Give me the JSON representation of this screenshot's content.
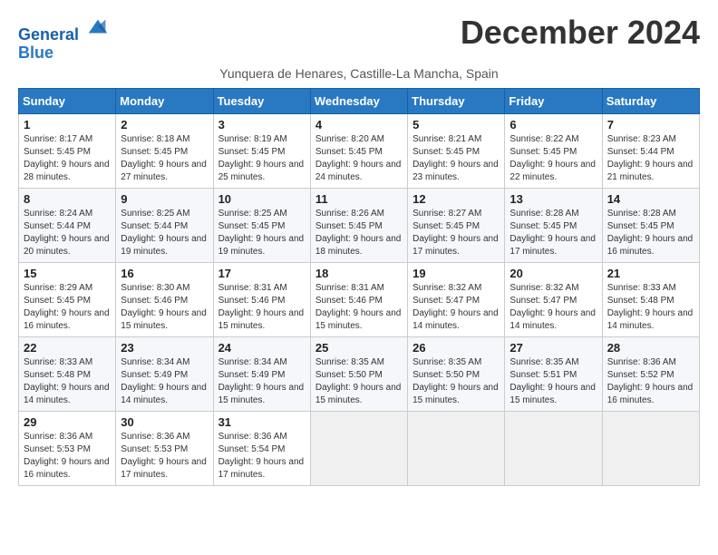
{
  "logo": {
    "line1": "General",
    "line2": "Blue"
  },
  "title": "December 2024",
  "subtitle": "Yunquera de Henares, Castille-La Mancha, Spain",
  "headers": [
    "Sunday",
    "Monday",
    "Tuesday",
    "Wednesday",
    "Thursday",
    "Friday",
    "Saturday"
  ],
  "weeks": [
    [
      {
        "day": "1",
        "sunrise": "8:17 AM",
        "sunset": "5:45 PM",
        "daylight": "9 hours and 28 minutes."
      },
      {
        "day": "2",
        "sunrise": "8:18 AM",
        "sunset": "5:45 PM",
        "daylight": "9 hours and 27 minutes."
      },
      {
        "day": "3",
        "sunrise": "8:19 AM",
        "sunset": "5:45 PM",
        "daylight": "9 hours and 25 minutes."
      },
      {
        "day": "4",
        "sunrise": "8:20 AM",
        "sunset": "5:45 PM",
        "daylight": "9 hours and 24 minutes."
      },
      {
        "day": "5",
        "sunrise": "8:21 AM",
        "sunset": "5:45 PM",
        "daylight": "9 hours and 23 minutes."
      },
      {
        "day": "6",
        "sunrise": "8:22 AM",
        "sunset": "5:45 PM",
        "daylight": "9 hours and 22 minutes."
      },
      {
        "day": "7",
        "sunrise": "8:23 AM",
        "sunset": "5:44 PM",
        "daylight": "9 hours and 21 minutes."
      }
    ],
    [
      {
        "day": "8",
        "sunrise": "8:24 AM",
        "sunset": "5:44 PM",
        "daylight": "9 hours and 20 minutes."
      },
      {
        "day": "9",
        "sunrise": "8:25 AM",
        "sunset": "5:44 PM",
        "daylight": "9 hours and 19 minutes."
      },
      {
        "day": "10",
        "sunrise": "8:25 AM",
        "sunset": "5:45 PM",
        "daylight": "9 hours and 19 minutes."
      },
      {
        "day": "11",
        "sunrise": "8:26 AM",
        "sunset": "5:45 PM",
        "daylight": "9 hours and 18 minutes."
      },
      {
        "day": "12",
        "sunrise": "8:27 AM",
        "sunset": "5:45 PM",
        "daylight": "9 hours and 17 minutes."
      },
      {
        "day": "13",
        "sunrise": "8:28 AM",
        "sunset": "5:45 PM",
        "daylight": "9 hours and 17 minutes."
      },
      {
        "day": "14",
        "sunrise": "8:28 AM",
        "sunset": "5:45 PM",
        "daylight": "9 hours and 16 minutes."
      }
    ],
    [
      {
        "day": "15",
        "sunrise": "8:29 AM",
        "sunset": "5:45 PM",
        "daylight": "9 hours and 16 minutes."
      },
      {
        "day": "16",
        "sunrise": "8:30 AM",
        "sunset": "5:46 PM",
        "daylight": "9 hours and 15 minutes."
      },
      {
        "day": "17",
        "sunrise": "8:31 AM",
        "sunset": "5:46 PM",
        "daylight": "9 hours and 15 minutes."
      },
      {
        "day": "18",
        "sunrise": "8:31 AM",
        "sunset": "5:46 PM",
        "daylight": "9 hours and 15 minutes."
      },
      {
        "day": "19",
        "sunrise": "8:32 AM",
        "sunset": "5:47 PM",
        "daylight": "9 hours and 14 minutes."
      },
      {
        "day": "20",
        "sunrise": "8:32 AM",
        "sunset": "5:47 PM",
        "daylight": "9 hours and 14 minutes."
      },
      {
        "day": "21",
        "sunrise": "8:33 AM",
        "sunset": "5:48 PM",
        "daylight": "9 hours and 14 minutes."
      }
    ],
    [
      {
        "day": "22",
        "sunrise": "8:33 AM",
        "sunset": "5:48 PM",
        "daylight": "9 hours and 14 minutes."
      },
      {
        "day": "23",
        "sunrise": "8:34 AM",
        "sunset": "5:49 PM",
        "daylight": "9 hours and 14 minutes."
      },
      {
        "day": "24",
        "sunrise": "8:34 AM",
        "sunset": "5:49 PM",
        "daylight": "9 hours and 15 minutes."
      },
      {
        "day": "25",
        "sunrise": "8:35 AM",
        "sunset": "5:50 PM",
        "daylight": "9 hours and 15 minutes."
      },
      {
        "day": "26",
        "sunrise": "8:35 AM",
        "sunset": "5:50 PM",
        "daylight": "9 hours and 15 minutes."
      },
      {
        "day": "27",
        "sunrise": "8:35 AM",
        "sunset": "5:51 PM",
        "daylight": "9 hours and 15 minutes."
      },
      {
        "day": "28",
        "sunrise": "8:36 AM",
        "sunset": "5:52 PM",
        "daylight": "9 hours and 16 minutes."
      }
    ],
    [
      {
        "day": "29",
        "sunrise": "8:36 AM",
        "sunset": "5:53 PM",
        "daylight": "9 hours and 16 minutes."
      },
      {
        "day": "30",
        "sunrise": "8:36 AM",
        "sunset": "5:53 PM",
        "daylight": "9 hours and 17 minutes."
      },
      {
        "day": "31",
        "sunrise": "8:36 AM",
        "sunset": "5:54 PM",
        "daylight": "9 hours and 17 minutes."
      },
      null,
      null,
      null,
      null
    ]
  ]
}
